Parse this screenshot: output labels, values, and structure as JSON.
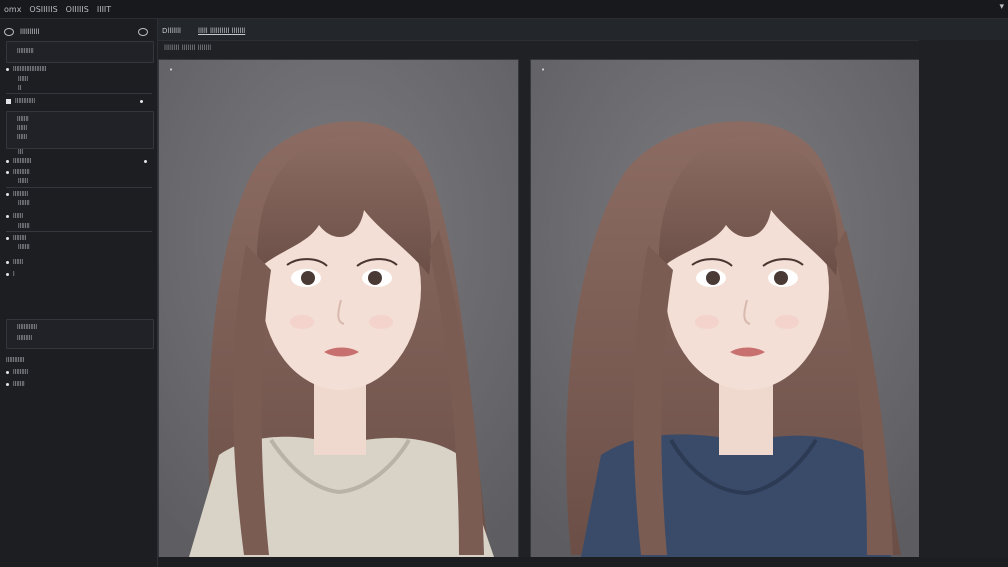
{
  "topbar": {
    "menu": [
      "omx",
      "OSIIIIIS",
      "OIIIIIS",
      "IIIIT"
    ]
  },
  "sidebar": {
    "header_label": "llllllllll",
    "rows": [
      {
        "text": "llllllllll",
        "marker": "none"
      },
      {
        "text": "llllllllllllllllllll",
        "marker": "dot"
      },
      {
        "text": "llllll",
        "marker": "none"
      },
      {
        "text": "ll",
        "marker": "none"
      },
      {
        "text": "llllllllllll",
        "marker": "sq"
      },
      {
        "text": "lllllll",
        "marker": "none"
      },
      {
        "text": "llllll",
        "marker": "none"
      },
      {
        "text": "llllll",
        "marker": "none"
      },
      {
        "text": "lll",
        "marker": "none"
      },
      {
        "text": "lllllllllll",
        "marker": "dot"
      },
      {
        "text": "llllllllll",
        "marker": "dot"
      },
      {
        "text": "llllll",
        "marker": "none"
      },
      {
        "text": "lllllllll",
        "marker": "dot"
      },
      {
        "text": "lllllll",
        "marker": "none"
      },
      {
        "text": "llllll",
        "marker": "dot"
      },
      {
        "text": "lllllll",
        "marker": "none"
      },
      {
        "text": "llllllll",
        "marker": "dot"
      },
      {
        "text": "lllllll",
        "marker": "none"
      },
      {
        "text": "llllll",
        "marker": "dot"
      },
      {
        "text": "l",
        "marker": "dot"
      },
      {
        "text": "llllllllllll",
        "marker": "none"
      },
      {
        "text": "lllllllll",
        "marker": "none"
      },
      {
        "text": "lllllllllll",
        "marker": "none"
      },
      {
        "text": "lllllllll",
        "marker": "dot"
      },
      {
        "text": "lllllll",
        "marker": "dot"
      }
    ]
  },
  "content": {
    "tabs": [
      "Dlllllll",
      "lllll llllllllll lllllll"
    ],
    "subhead": "llllllll lllllll lllllll",
    "left_marker": "•",
    "right_marker": "•"
  },
  "colors": {
    "background": "#1f2125",
    "panel": "#6b6b6f",
    "hair": "#8a6a60",
    "sweater_left": "#d8d2c7",
    "sweater_right": "#3a4b6a"
  }
}
